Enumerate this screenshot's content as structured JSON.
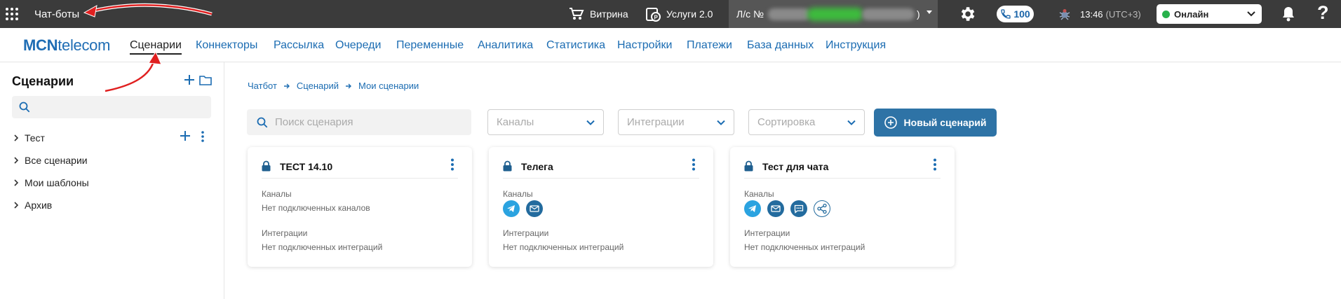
{
  "topbar": {
    "app_title": "Чат-боты",
    "showcase_label": "Витрина",
    "services_label": "Услуги 2.0",
    "account_label": "Л/с №",
    "account_suffix": ")",
    "calls_count": "100",
    "time": "13:46",
    "timezone": "(UTC+3)",
    "status": "Онлайн",
    "help": "?",
    "colors": {
      "bg": "#3b3b3b",
      "status_green": "#28b14c",
      "calls_blue": "#1a64a8"
    },
    "icons": [
      "apps-grid-icon",
      "cart-icon",
      "services-icon",
      "gear-icon",
      "phone-icon",
      "bug-icon",
      "bell-icon"
    ]
  },
  "nav": {
    "logo_bold": "MCN",
    "logo_rest": "telecom",
    "items": [
      {
        "label": "Сценарии",
        "active": true
      },
      {
        "label": "Коннекторы"
      },
      {
        "label": "Рассылка"
      },
      {
        "label": "Очереди"
      },
      {
        "label": "Переменные"
      },
      {
        "label": "Аналитика"
      },
      {
        "label": "Статистика"
      },
      {
        "label": "Настройки"
      },
      {
        "label": "Платежи"
      },
      {
        "label": "База данных"
      },
      {
        "label": "Инструкция"
      }
    ]
  },
  "sidebar": {
    "title": "Сценарии",
    "search_value": "",
    "tree": [
      {
        "label": "Тест"
      },
      {
        "label": "Все сценарии"
      },
      {
        "label": "Мои шаблоны"
      },
      {
        "label": "Архив"
      }
    ]
  },
  "main": {
    "breadcrumbs": [
      "Чатбот",
      "Сценарий",
      "Мои сценарии"
    ],
    "search_placeholder": "Поиск сценария",
    "filters": {
      "channels": "Каналы",
      "integrations": "Интеграции",
      "sort": "Сортировка"
    },
    "new_button": "Новый сценарий",
    "accent": "#2e73a6",
    "cards": [
      {
        "title": "ТЕСТ 14.10",
        "channels_label": "Каналы",
        "channels_text": "Нет подключенных каналов",
        "channels": [],
        "integrations_label": "Интеграции",
        "integrations_text": "Нет подключенных интеграций"
      },
      {
        "title": "Телега",
        "channels_label": "Каналы",
        "channels": [
          "telegram-icon",
          "mail-icon"
        ],
        "integrations_label": "Интеграции",
        "integrations_text": "Нет подключенных интеграций"
      },
      {
        "title": "Тест для чата",
        "channels_label": "Каналы",
        "channels": [
          "telegram-icon",
          "mail-icon",
          "chat-icon",
          "share-icon"
        ],
        "integrations_label": "Интеграции",
        "integrations_text": "Нет подключенных интеграций"
      }
    ]
  }
}
